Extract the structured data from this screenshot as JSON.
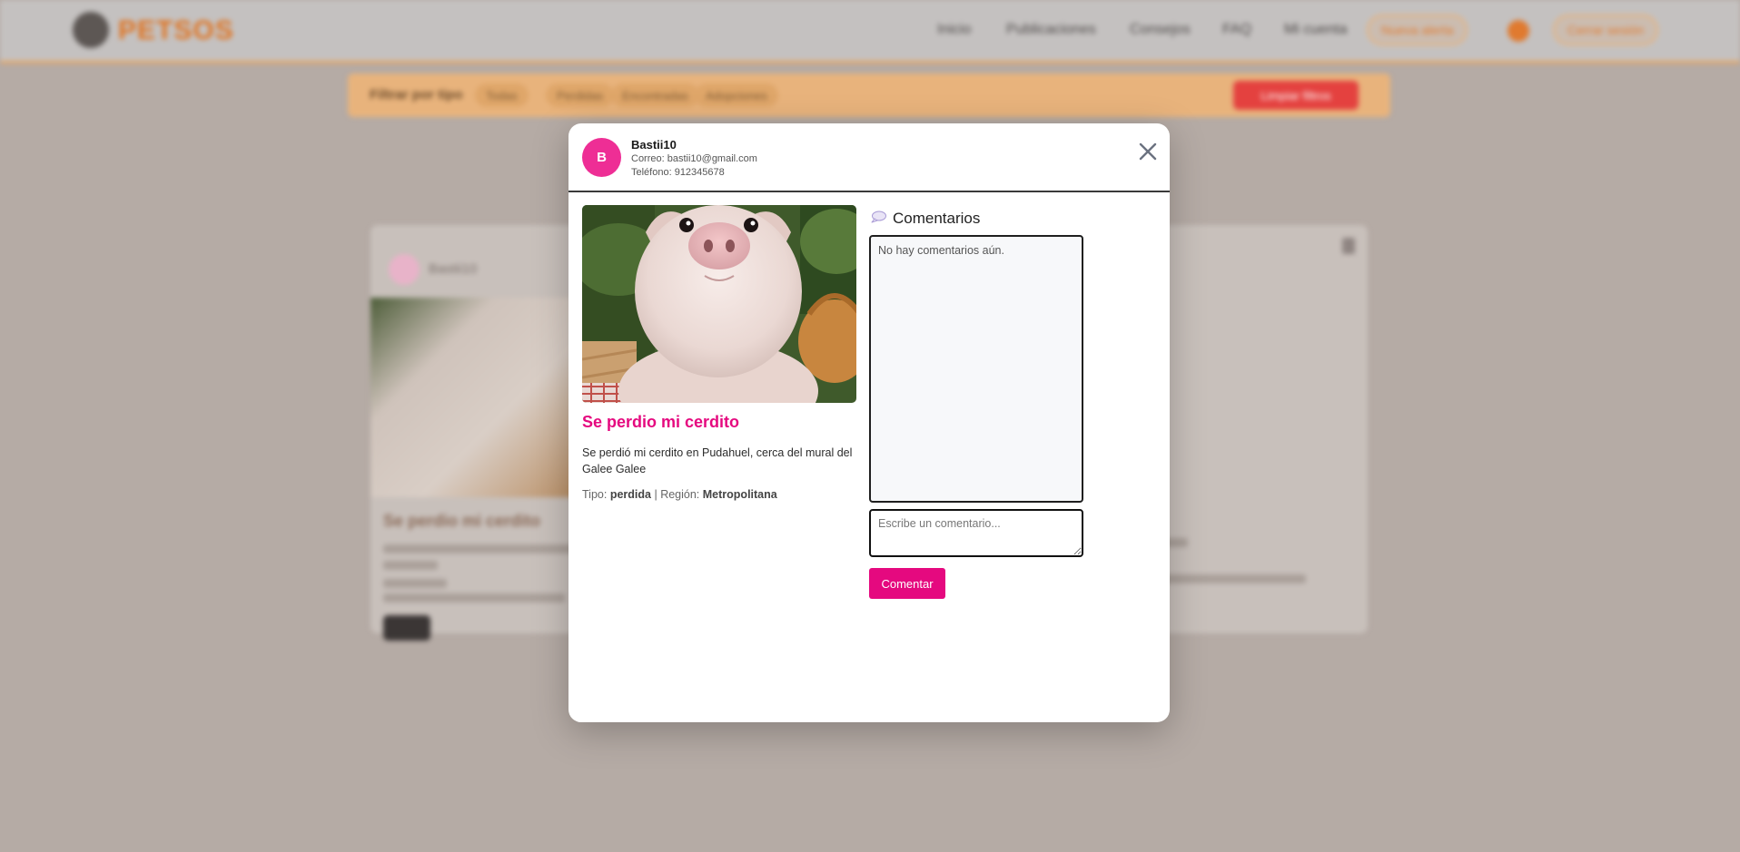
{
  "background": {
    "brand": "PETSOS",
    "nav": [
      "Inicio",
      "Publicaciones",
      "Consejos",
      "FAQ",
      "Mi cuenta"
    ],
    "nav_button": "Nueva alerta",
    "logout_button": "Cerrar sesión",
    "filter_title": "Filtrar por tipo",
    "chips": [
      "Todas",
      "Perdidas",
      "Encontradas",
      "Adopciones"
    ],
    "filter_button": "Limpiar filtros",
    "card": {
      "author": "Bastii10",
      "title": "Se perdio mi cerdito"
    }
  },
  "modal": {
    "avatar_letter": "B",
    "user_name": "Bastii10",
    "email": "Correo: bastii10@gmail.com",
    "phone": "Teléfono: 912345678",
    "post_title": "Se perdio mi cerdito",
    "post_description": "Se perdió mi cerdito en Pudahuel, cerca del mural del Galee Galee",
    "meta": {
      "type_label": "Tipo:",
      "type_value": "perdida",
      "separator": "|",
      "region_label": "Región:",
      "region_value": "Metropolitana"
    },
    "comments": {
      "title": "Comentarios",
      "empty_text": "No hay comentarios aún.",
      "input_placeholder": "Escribe un comentario...",
      "submit_label": "Comentar"
    }
  },
  "colors": {
    "accent": "#e5097f",
    "avatar": "#ee2e95",
    "brand_orange": "#e07320"
  },
  "icons": {
    "close": "close-icon",
    "comments": "speech-bubble-icon"
  }
}
